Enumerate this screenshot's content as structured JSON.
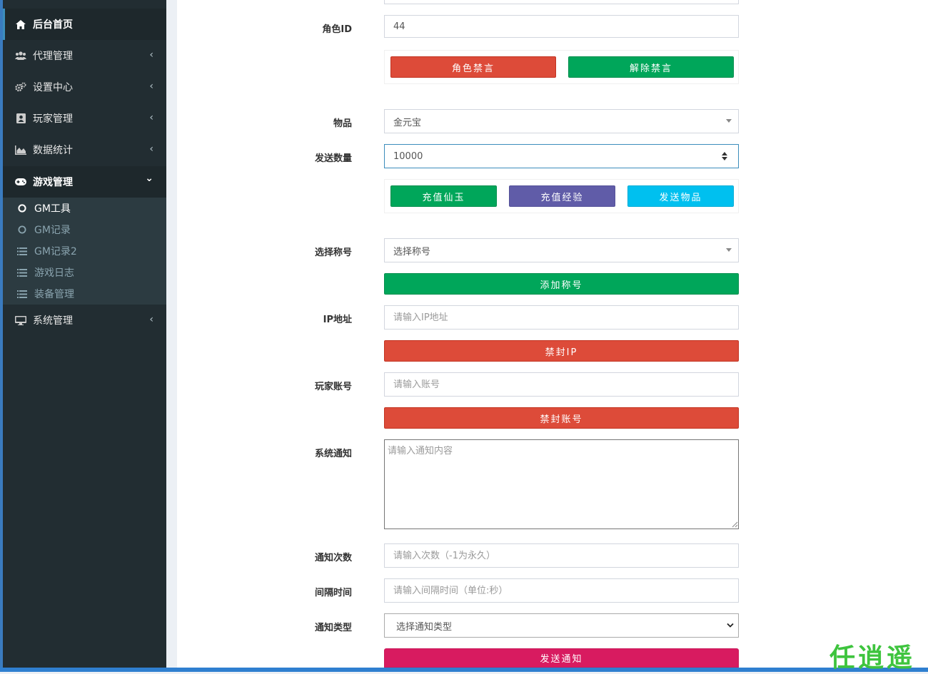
{
  "sidebar": {
    "items": [
      {
        "label": "后台首页",
        "icon": "home-icon"
      },
      {
        "label": "代理管理",
        "icon": "users-icon"
      },
      {
        "label": "设置中心",
        "icon": "gears-icon"
      },
      {
        "label": "玩家管理",
        "icon": "address-book-icon"
      },
      {
        "label": "数据统计",
        "icon": "area-chart-icon"
      },
      {
        "label": "游戏管理",
        "icon": "gamepad-icon"
      },
      {
        "label": "系统管理",
        "icon": "desktop-icon"
      }
    ],
    "submenu": [
      {
        "label": "GM工具",
        "icon": "circle-icon"
      },
      {
        "label": "GM记录",
        "icon": "circle-icon"
      },
      {
        "label": "GM记录2",
        "icon": "list-icon"
      },
      {
        "label": "游戏日志",
        "icon": "list-icon"
      },
      {
        "label": "装备管理",
        "icon": "list-icon"
      }
    ],
    "chevron_left": "‹",
    "chevron_down": "⌄"
  },
  "form": {
    "role_id": {
      "label": "角色ID",
      "value": "44"
    },
    "mute_buttons": {
      "mute": "角色禁言",
      "unmute": "解除禁言"
    },
    "item": {
      "label": "物品",
      "value": "金元宝"
    },
    "quantity": {
      "label": "发送数量",
      "value": "10000"
    },
    "send_buttons": {
      "recharge_jade": "充值仙玉",
      "recharge_exp": "充值经验",
      "send_item": "发送物品"
    },
    "title": {
      "label": "选择称号",
      "value": "选择称号",
      "button": "添加称号"
    },
    "ip": {
      "label": "IP地址",
      "placeholder": "请输入IP地址",
      "button": "禁封IP"
    },
    "account": {
      "label": "玩家账号",
      "placeholder": "请输入账号",
      "button": "禁封账号"
    },
    "notice": {
      "label": "系统通知",
      "placeholder": "请输入通知内容"
    },
    "notice_count": {
      "label": "通知次数",
      "placeholder": "请输入次数（-1为永久）"
    },
    "interval": {
      "label": "间隔时间",
      "placeholder": "请输入间隔时间（单位:秒）"
    },
    "notice_type": {
      "label": "通知类型",
      "value": "选择通知类型",
      "button": "发送通知"
    }
  },
  "watermark": "任逍遥",
  "colors": {
    "sidebar_bg": "#222d32",
    "submenu_bg": "#2c3b41",
    "red": "#dd4b39",
    "green": "#00a65a",
    "purple": "#605ca8",
    "aqua": "#00c0ef",
    "maroon": "#d81b60",
    "accent": "#3c8dbc"
  }
}
